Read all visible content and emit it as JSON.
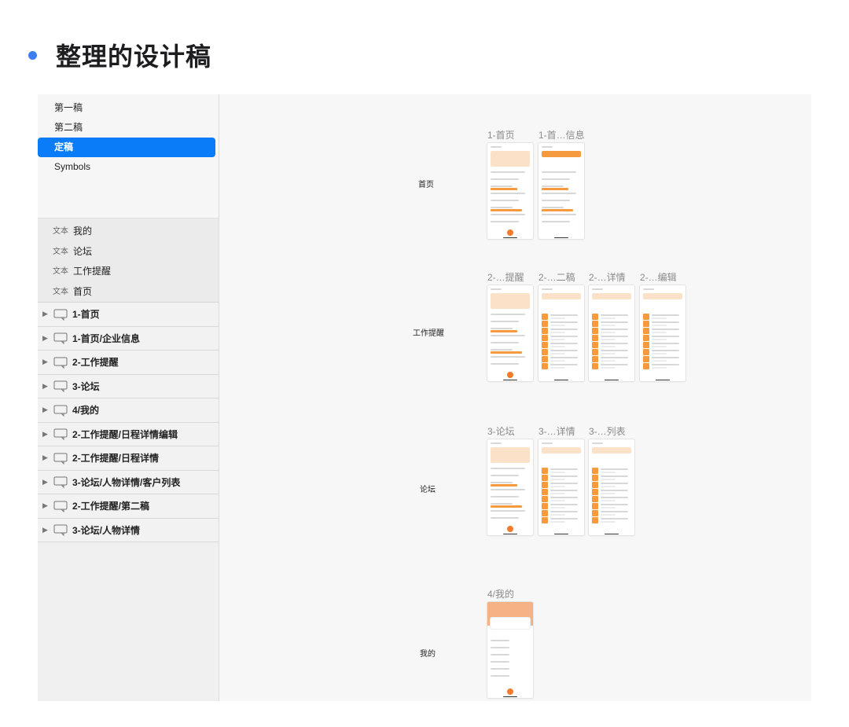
{
  "heading": {
    "title": "整理的设计稿",
    "bullet_color": "#3d7ef5"
  },
  "sidebar": {
    "pages": [
      {
        "label": "第一稿",
        "active": false
      },
      {
        "label": "第二稿",
        "active": false
      },
      {
        "label": "定稿",
        "active": true
      },
      {
        "label": "Symbols",
        "active": false
      }
    ],
    "text_layers": [
      {
        "kind": "文本",
        "name": "我的"
      },
      {
        "kind": "文本",
        "name": "论坛"
      },
      {
        "kind": "文本",
        "name": "工作提醒"
      },
      {
        "kind": "文本",
        "name": "首页"
      }
    ],
    "artboards": [
      "1-首页",
      "1-首页/企业信息",
      "2-工作提醒",
      "3-论坛",
      "4/我的",
      "2-工作提醒/日程详情编辑",
      "2-工作提醒/日程详情",
      "3-论坛/人物详情/客户列表",
      "2-工作提醒/第二稿",
      "3-论坛/人物详情"
    ],
    "active_color": "#0a7cf7"
  },
  "canvas": {
    "rows": [
      {
        "label": "首页",
        "artboards": [
          "1-首页",
          "1-首…信息"
        ]
      },
      {
        "label": "工作提醒",
        "artboards": [
          "2-…提醒",
          "2-…二稿",
          "2-…详情",
          "2-…编辑"
        ]
      },
      {
        "label": "论坛",
        "artboards": [
          "3-论坛",
          "3-…详情",
          "3-…列表"
        ]
      },
      {
        "label": "我的",
        "artboards": [
          "4/我的"
        ]
      }
    ],
    "accent_color": "#f59a3e"
  }
}
